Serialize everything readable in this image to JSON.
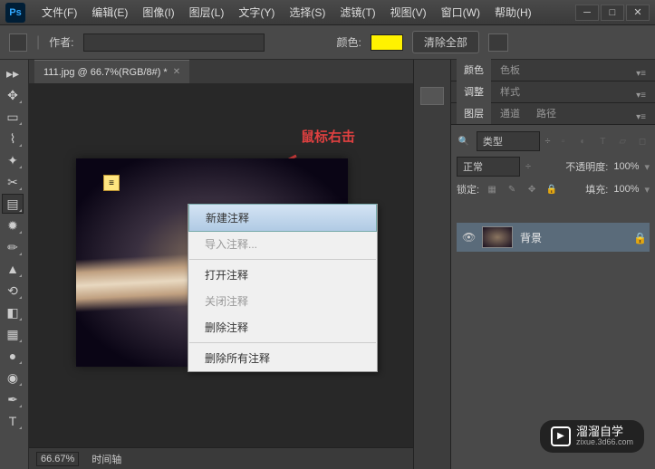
{
  "menu": [
    "文件(F)",
    "编辑(E)",
    "图像(I)",
    "图层(L)",
    "文字(Y)",
    "选择(S)",
    "滤镜(T)",
    "视图(V)",
    "窗口(W)",
    "帮助(H)"
  ],
  "options": {
    "author_label": "作者:",
    "color_label": "颜色:",
    "swatch": "#fff200",
    "clear_btn": "清除全部"
  },
  "doc_tab": "111.jpg @ 66.7%(RGB/8#) *",
  "annotation": "鼠标右击",
  "context_menu": {
    "new_note": "新建注释",
    "import_note": "导入注释...",
    "open_note": "打开注释",
    "close_note": "关闭注释",
    "delete_note": "删除注释",
    "delete_all": "删除所有注释"
  },
  "status": {
    "zoom": "66.67%",
    "timeline": "时间轴"
  },
  "panels": {
    "color_tab": "颜色",
    "swatch_tab": "色板",
    "adjust_tab": "调整",
    "style_tab": "样式",
    "layers_tab": "图层",
    "channels_tab": "通道",
    "paths_tab": "路径",
    "kind_label": "类型",
    "blend_mode": "正常",
    "opacity_label": "不透明度:",
    "opacity_val": "100%",
    "lock_label": "锁定:",
    "fill_label": "填充:",
    "fill_val": "100%",
    "layer_name": "背景"
  },
  "watermark": {
    "title": "溜溜自学",
    "url": "zixue.3d66.com"
  }
}
